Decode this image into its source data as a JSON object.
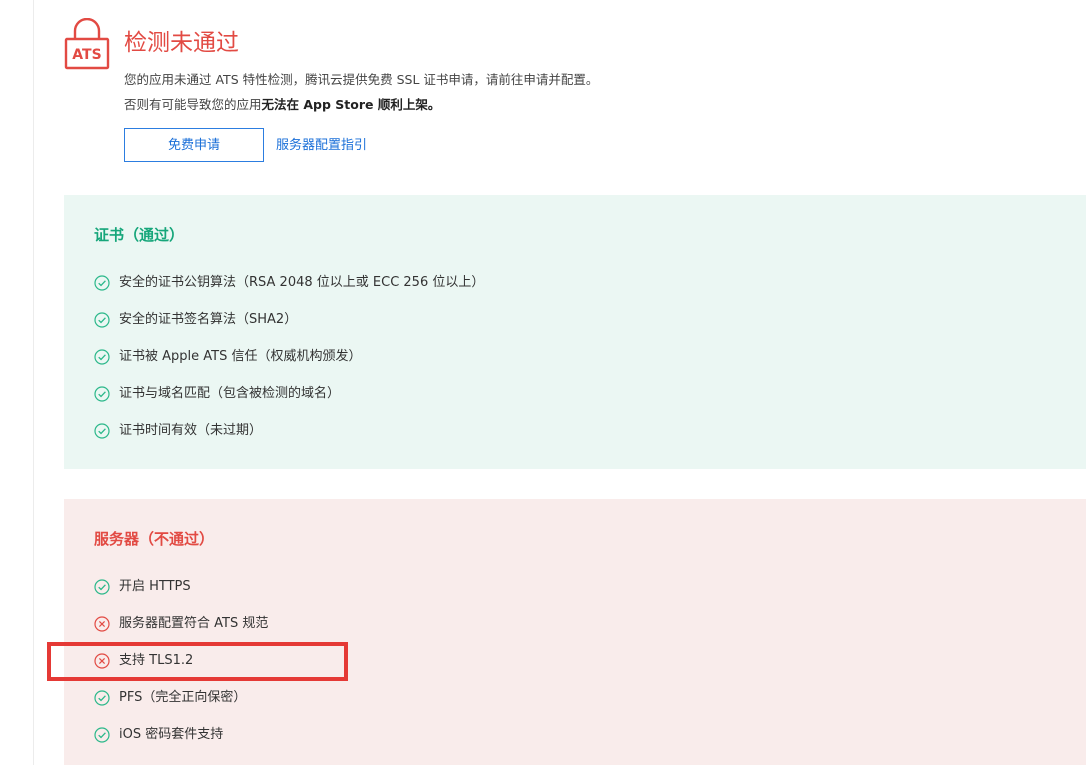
{
  "header": {
    "badge_text": "ATS",
    "title": "检测未通过",
    "desc_line1": "您的应用未通过 ATS 特性检测，腾讯云提供免费 SSL 证书申请，请前往申请并配置。",
    "desc_line2_prefix": "否则有可能导致您的应用",
    "desc_line2_bold": "无法在 App Store 顺利上架。",
    "apply_button": "免费申请",
    "guide_link": "服务器配置指引"
  },
  "cert": {
    "title": "证书（通过）",
    "items": [
      {
        "label": "安全的证书公钥算法（RSA 2048 位以上或 ECC 256 位以上）",
        "status": "pass"
      },
      {
        "label": "安全的证书签名算法（SHA2）",
        "status": "pass"
      },
      {
        "label": "证书被 Apple ATS 信任（权威机构颁发）",
        "status": "pass"
      },
      {
        "label": "证书与域名匹配（包含被检测的域名）",
        "status": "pass"
      },
      {
        "label": "证书时间有效（未过期）",
        "status": "pass"
      }
    ]
  },
  "server": {
    "title": "服务器（不通过）",
    "items": [
      {
        "label": "开启 HTTPS",
        "status": "pass"
      },
      {
        "label": "服务器配置符合 ATS 规范",
        "status": "fail"
      },
      {
        "label": "支持 TLS1.2",
        "status": "fail"
      },
      {
        "label": "PFS（完全正向保密）",
        "status": "pass"
      },
      {
        "label": "iOS 密码套件支持",
        "status": "pass"
      }
    ]
  },
  "colors": {
    "pass": "#2bb88a",
    "fail": "#e24a43",
    "accent": "#1a6fd8",
    "annotation": "#e53935"
  }
}
